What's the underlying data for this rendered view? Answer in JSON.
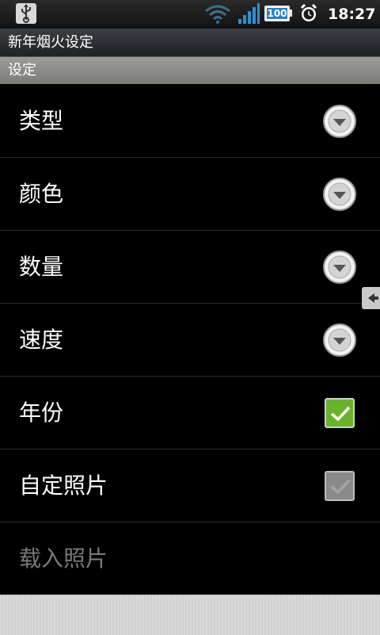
{
  "status_bar": {
    "time": "18:27",
    "battery": 100,
    "battery_label": "100",
    "icons": [
      "usb-icon",
      "wifi-icon",
      "signal-icon",
      "battery-icon",
      "alarm-icon"
    ]
  },
  "app": {
    "title": "新年烟火设定"
  },
  "section": {
    "header": "设定"
  },
  "settings": {
    "items": [
      {
        "label": "类型",
        "control": "dropdown"
      },
      {
        "label": "颜色",
        "control": "dropdown"
      },
      {
        "label": "数量",
        "control": "dropdown"
      },
      {
        "label": "速度",
        "control": "dropdown"
      },
      {
        "label": "年份",
        "control": "checkbox",
        "checked": true,
        "enabled": true
      },
      {
        "label": "自定照片",
        "control": "checkbox",
        "checked": true,
        "enabled": false
      },
      {
        "label": "载入照片",
        "control": "none",
        "enabled": false
      }
    ]
  },
  "colors": {
    "checkbox_on": "#6ab22e",
    "battery": "#2a7fc2",
    "section_bg": "#8e8e8a"
  }
}
